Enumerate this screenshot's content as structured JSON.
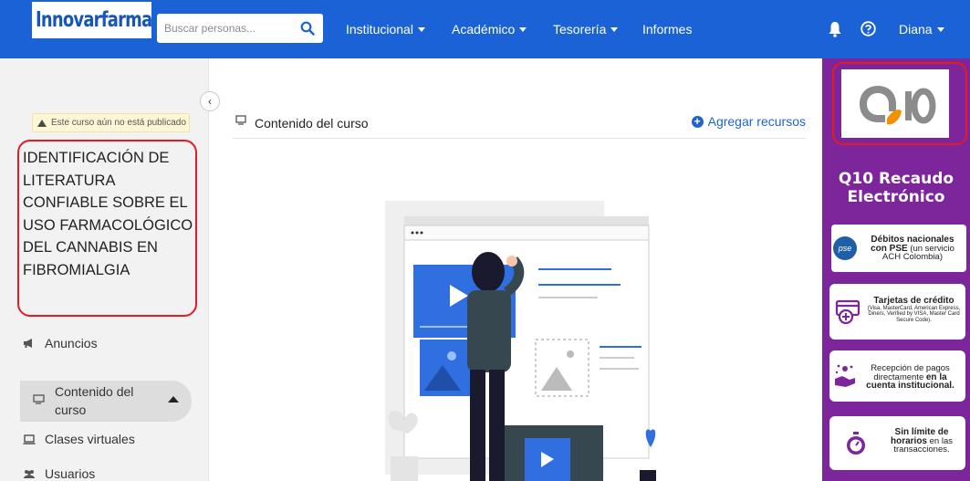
{
  "brand": {
    "name": "Innovarfarma"
  },
  "search": {
    "placeholder": "Buscar personas..."
  },
  "nav": {
    "institucional": "Institucional",
    "academico": "Académico",
    "tesoreria": "Tesorería",
    "informes": "Informes",
    "user": "Diana"
  },
  "sidebar": {
    "unpublished_notice": "Este curso aún no está publicado",
    "course_title": "IDENTIFICACIÓN DE LITERATURA CONFIABLE SOBRE EL USO FARMACOLÓGICO DEL CANNABIS EN FIBROMIALGIA",
    "items": [
      {
        "label": "Anuncios",
        "icon": "megaphone-icon"
      },
      {
        "label": "Contenido del curso",
        "icon": "content-icon",
        "active": true
      },
      {
        "label": "Clases virtuales",
        "icon": "laptop-icon"
      },
      {
        "label": "Usuarios",
        "icon": "users-icon"
      }
    ]
  },
  "main": {
    "section_title": "Contenido del curso",
    "add_resources": "Agregar recursos"
  },
  "ad": {
    "logo_text": "Q10",
    "title_line1": "Q10 Recaudo",
    "title_line2": "Electrónico",
    "cards": {
      "pse_line1": "Débitos nacionales",
      "pse_line2": "con PSE",
      "pse_line3": "(un servicio",
      "pse_line4": "ACH Colombia)",
      "pse_logo": "pse",
      "cc_title": "Tarjetas de crédito",
      "cc_detail": "(Visa, MasterCard, American Express, Diners, Verified by VISA, Master Card Secure Code).",
      "recv_line1": "Recepción de pagos",
      "recv_line2": "directamente",
      "recv_line2b": "en la",
      "recv_line3": "cuenta institucional.",
      "hours_line1": "Sin límite de",
      "hours_line2": "horarios",
      "hours_line2b": "en las",
      "hours_line3": "transacciones."
    },
    "colors": {
      "background": "#7d269c",
      "highlight": "#e31b23"
    }
  },
  "colors": {
    "topbar": "#1a62d6",
    "link": "#1e63d0"
  }
}
